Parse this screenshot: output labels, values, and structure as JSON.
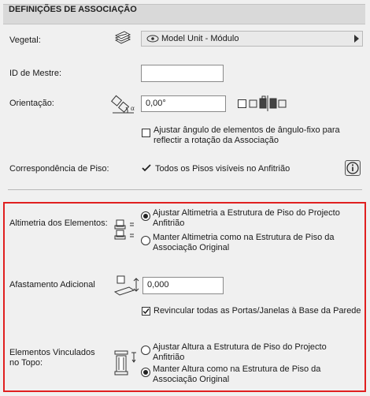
{
  "header": {
    "title": "DEFINIÇÕES DE ASSOCIAÇÃO"
  },
  "vegetal": {
    "label": "Vegetal:",
    "value": "Model Unit - Módulo"
  },
  "master_id": {
    "label": "ID de Mestre:",
    "value": ""
  },
  "orientation": {
    "label": "Orientação:",
    "value": "0,00°",
    "adjust_label": "Ajustar ângulo de elementos de ângulo-fixo para reflectir a rotação da Associação",
    "adjust_checked": false
  },
  "floor_match": {
    "label": "Correspondência de Piso:",
    "value": "Todos os Pisos visíveis no Anfitrião"
  },
  "elevation": {
    "label": "Altimetria dos Elementos:",
    "options": [
      {
        "text": "Ajustar Altimetria a Estrutura de Piso do Projecto Anfitrião",
        "selected": true
      },
      {
        "text": "Manter Altimetria como na Estrutura de Piso da Associação Original",
        "selected": false
      }
    ]
  },
  "offset": {
    "label": "Afastamento Adicional",
    "value": "0,000",
    "relink_label": "Revincular todas as Portas/Janelas à Base da Parede",
    "relink_checked": true
  },
  "top_linked": {
    "label": "Elementos Vinculados no Topo:",
    "options": [
      {
        "text": "Ajustar Altura a Estrutura de Piso do Projecto Anfitrião",
        "selected": false
      },
      {
        "text": "Manter Altura como na Estrutura de Piso da Associação Original",
        "selected": true
      }
    ]
  }
}
